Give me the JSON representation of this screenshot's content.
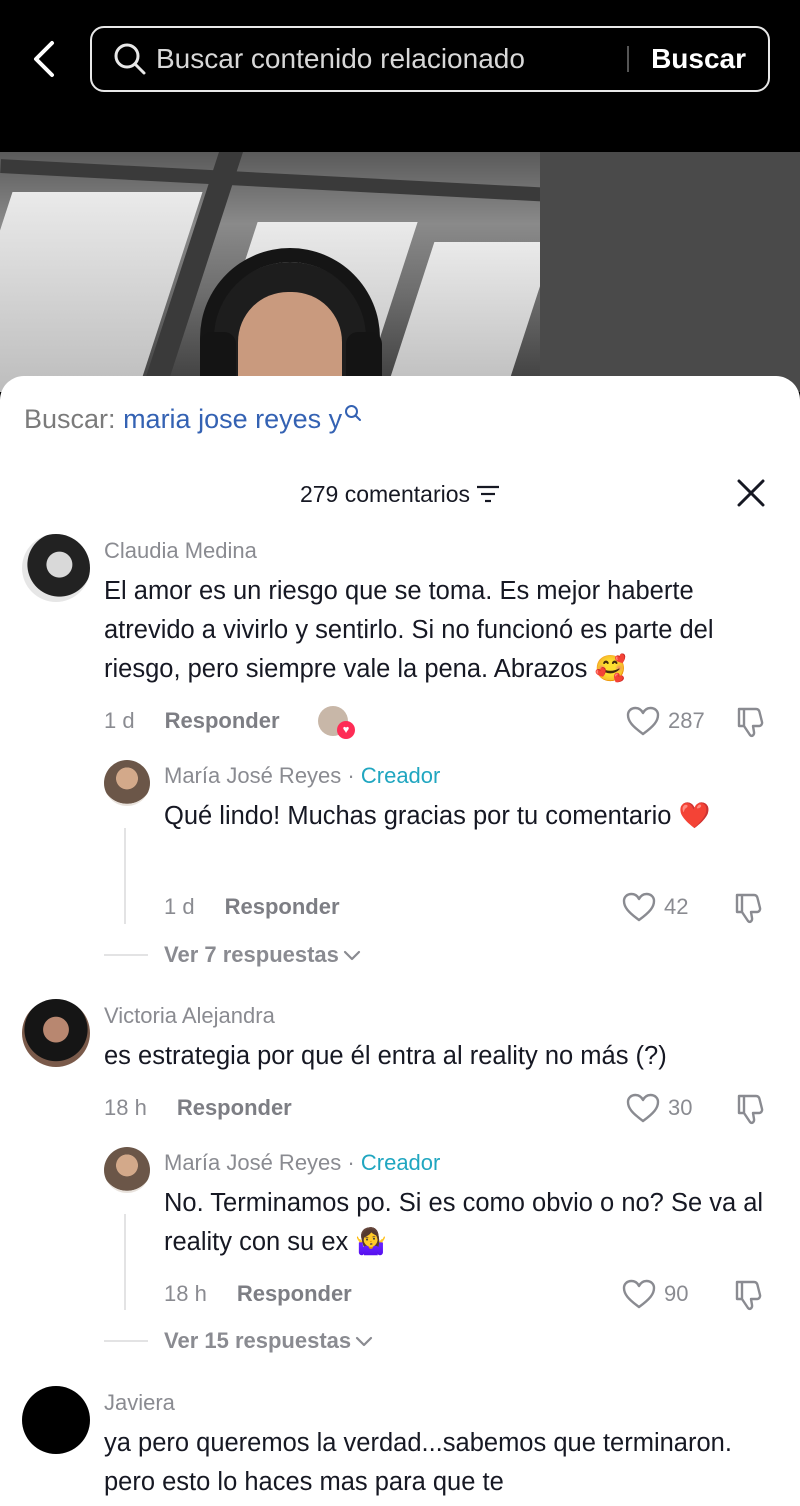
{
  "header": {
    "search_placeholder": "Buscar contenido relacionado",
    "search_button": "Buscar"
  },
  "sheet": {
    "search_prefix": "Buscar:",
    "search_query": "maria jose reyes y",
    "comment_count": "279 comentarios"
  },
  "comments": [
    {
      "author": "Claudia Medina",
      "text": "El amor es un riesgo que se toma. Es mejor haberte atrevido a vivirlo y sentirlo. Si no funcionó es parte del riesgo, pero siempre vale la pena. Abrazos 🥰",
      "time": "1 d",
      "reply_label": "Responder",
      "likes": "287",
      "reply": {
        "author": "María José Reyes",
        "dot": "·",
        "creator_badge": "Creador",
        "text": "Qué lindo! Muchas gracias por tu comentario ❤️",
        "time": "1 d",
        "reply_label": "Responder",
        "likes": "42"
      },
      "more_replies": "Ver 7 respuestas"
    },
    {
      "author": "Victoria Alejandra",
      "text": "es estrategia por que él entra al reality no más (?)",
      "time": "18 h",
      "reply_label": "Responder",
      "likes": "30",
      "reply": {
        "author": "María José Reyes",
        "dot": "·",
        "creator_badge": "Creador",
        "text": "No. Terminamos po. Si es como obvio o no? Se va al reality con su ex 🤷‍♀️",
        "time": "18 h",
        "reply_label": "Responder",
        "likes": "90"
      },
      "more_replies": "Ver 15 respuestas"
    },
    {
      "author": "Javiera",
      "text": "ya pero queremos la verdad...sabemos que terminaron. pero esto lo haces mas para que te"
    }
  ],
  "icons": {
    "back": "chevron-left-icon",
    "search": "search-icon",
    "filter": "filter-icon",
    "close": "close-icon",
    "like": "heart-outline-icon",
    "dislike": "thumbs-down-icon",
    "expand": "chevron-down-icon"
  },
  "colors": {
    "link_blue": "#3462b3",
    "creator_teal": "#20a6c0",
    "muted_gray": "#8a8b91",
    "text_dark": "#161823"
  }
}
